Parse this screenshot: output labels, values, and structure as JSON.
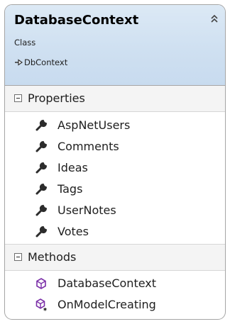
{
  "class": {
    "name": "DatabaseContext",
    "kind": "Class",
    "base_class": "DbContext"
  },
  "icons": {
    "collapse": "double-chevron-up-icon",
    "inherit": "inheritance-arrow-icon",
    "property": "wrench-property-icon",
    "method": "method-cube-icon",
    "protected_method": "protected-method-cube-icon"
  },
  "colors": {
    "header_background": "#cfe0f1",
    "border": "#a5a5a5",
    "method_icon": "#7b2fa8"
  },
  "properties": {
    "label": "Properties",
    "items": [
      "AspNetUsers",
      "Comments",
      "Ideas",
      "Tags",
      "UserNotes",
      "Votes"
    ]
  },
  "methods": {
    "label": "Methods",
    "items": [
      "DatabaseContext",
      "OnModelCreating"
    ]
  }
}
